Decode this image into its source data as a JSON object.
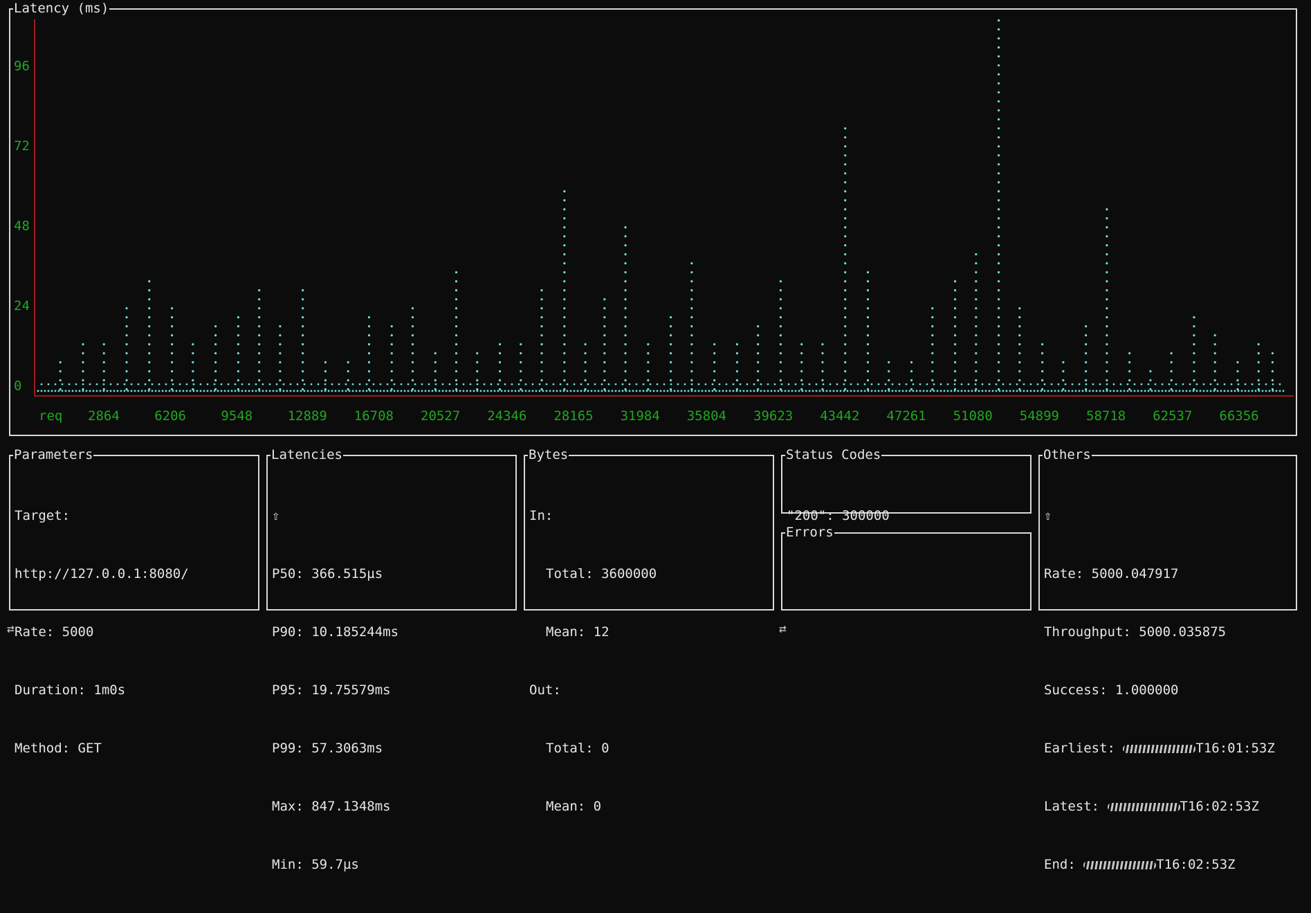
{
  "chart_panel": {
    "title": "Latency (ms)"
  },
  "chart_data": {
    "type": "scatter",
    "title": "Latency (ms)",
    "xlabel": "req",
    "x_ticks": [
      "2864",
      "6206",
      "9548",
      "12889",
      "16708",
      "20527",
      "24346",
      "28165",
      "31984",
      "35804",
      "39623",
      "43442",
      "47261",
      "51080",
      "54899",
      "58718",
      "62537",
      "66356"
    ],
    "y_ticks": [
      0,
      24,
      48,
      72,
      96
    ],
    "ylim": [
      -3,
      110
    ],
    "xlim": [
      0,
      71000
    ],
    "grid": false,
    "colors": {
      "points": "#6ee0e0",
      "axis": "#d02020",
      "ticks": "#1fa81f"
    },
    "series": [
      {
        "x": [
          1000,
          2300,
          3500,
          4800,
          6100,
          7400,
          8600,
          9900,
          11200,
          12400,
          13600,
          14900,
          16200,
          17500,
          18700,
          20000,
          21200,
          22500,
          23700,
          24900,
          26200,
          27400,
          28600,
          29900,
          31100,
          32200,
          33400,
          34700,
          36000,
          37200,
          38500,
          39800,
          41000,
          42300,
          43500,
          44700,
          46000,
          47300,
          48500,
          49800,
          51000,
          52300,
          53500,
          54800,
          56000,
          57300,
          58500,
          59800,
          61000,
          62300,
          63500,
          64700,
          66000,
          67200,
          68500,
          69700,
          70500
        ],
        "y": [
          8,
          14,
          14,
          24,
          33,
          24,
          14,
          19,
          23,
          29,
          18,
          31,
          8,
          9,
          23,
          19,
          24,
          10,
          35,
          11,
          14,
          14,
          30,
          61,
          14,
          26,
          48,
          14,
          23,
          38,
          14,
          15,
          19,
          32,
          13,
          14,
          79,
          36,
          8,
          9,
          25,
          33,
          42,
          110,
          25,
          14,
          9,
          18,
          54,
          12,
          6,
          11,
          22,
          17,
          9,
          14,
          11
        ]
      }
    ]
  },
  "parameters": {
    "title": "Parameters",
    "target_label": "Target:",
    "target_value": "http://127.0.0.1:8080/",
    "rate": "Rate: 5000",
    "duration": "Duration: 1m0s",
    "method": "Method: GET"
  },
  "latencies": {
    "title": "Latencies",
    "arrow": "⇧",
    "p50": "P50: 366.515µs",
    "p90": "P90: 10.185244ms",
    "p95": "P95: 19.75579ms",
    "p99": "P99: 57.3063ms",
    "max": "Max: 847.1348ms",
    "min": "Min: 59.7µs"
  },
  "bytes": {
    "title": "Bytes",
    "in_label": "In:",
    "in_total": "Total: 3600000",
    "in_mean": "Mean: 12",
    "out_label": "Out:",
    "out_total": "Total: 0",
    "out_mean": "Mean: 0"
  },
  "status_codes": {
    "title": "Status Codes",
    "line": "\"200\": 300000"
  },
  "errors": {
    "title": "Errors"
  },
  "others": {
    "title": "Others",
    "arrow": "⇧",
    "rate": "Rate: 5000.047917",
    "throughput": "Throughput: 5000.035875",
    "success": "Success: 1.000000",
    "earliest_label": "Earliest: ",
    "earliest_tail": "T16:01:53Z",
    "latest_label": "Latest: ",
    "latest_tail": "T16:02:53Z",
    "end_label": "End: ",
    "end_tail": "T16:02:53Z"
  },
  "footer": {
    "left_symbol": "⇄",
    "right_symbol": "⇄"
  }
}
